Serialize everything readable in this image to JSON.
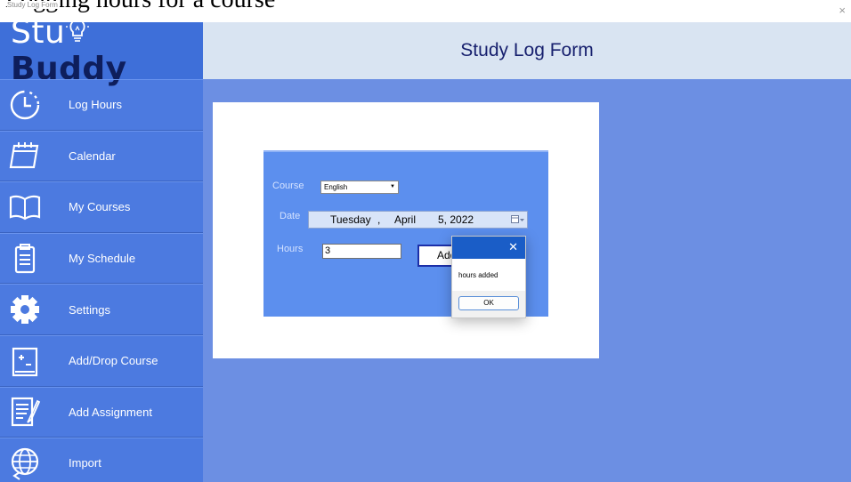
{
  "document": {
    "heading": "Logging hours for a course"
  },
  "window": {
    "title": "Study Log Form",
    "close_glyph": "×"
  },
  "logo": {
    "part1": "Stu",
    "part2": "Buddy",
    "hidden_letters": "dy",
    "icon": "lightbulb-icon"
  },
  "sidebar": {
    "items": [
      {
        "label": "Log Hours",
        "icon": "clock-icon"
      },
      {
        "label": "Calendar",
        "icon": "calendar-icon"
      },
      {
        "label": "My Courses",
        "icon": "book-icon"
      },
      {
        "label": "My Schedule",
        "icon": "clipboard-icon"
      },
      {
        "label": "Settings",
        "icon": "gear-icon"
      },
      {
        "label": "Add/Drop Course",
        "icon": "plus-minus-icon"
      },
      {
        "label": "Add Assignment",
        "icon": "notepad-icon"
      },
      {
        "label": "Import",
        "icon": "globe-icon"
      }
    ]
  },
  "header": {
    "title": "Study Log Form"
  },
  "form": {
    "course_label": "Course",
    "course_value": "English",
    "date_label": "Date",
    "date": {
      "weekday": "Tuesday",
      "sep": ",",
      "month": "April",
      "day_year": "5, 2022"
    },
    "hours_label": "Hours",
    "hours_value": "3",
    "add_label": "Add"
  },
  "dialog": {
    "message": "hours added",
    "ok_label": "OK",
    "close_glyph": "✕"
  },
  "colors": {
    "sidebar": "#4c7ae0",
    "header": "#d9e4f2",
    "main": "#6c8fe3",
    "form": "#5c8fee",
    "dialog_title": "#1a5dc7",
    "title_text": "#17206e"
  }
}
